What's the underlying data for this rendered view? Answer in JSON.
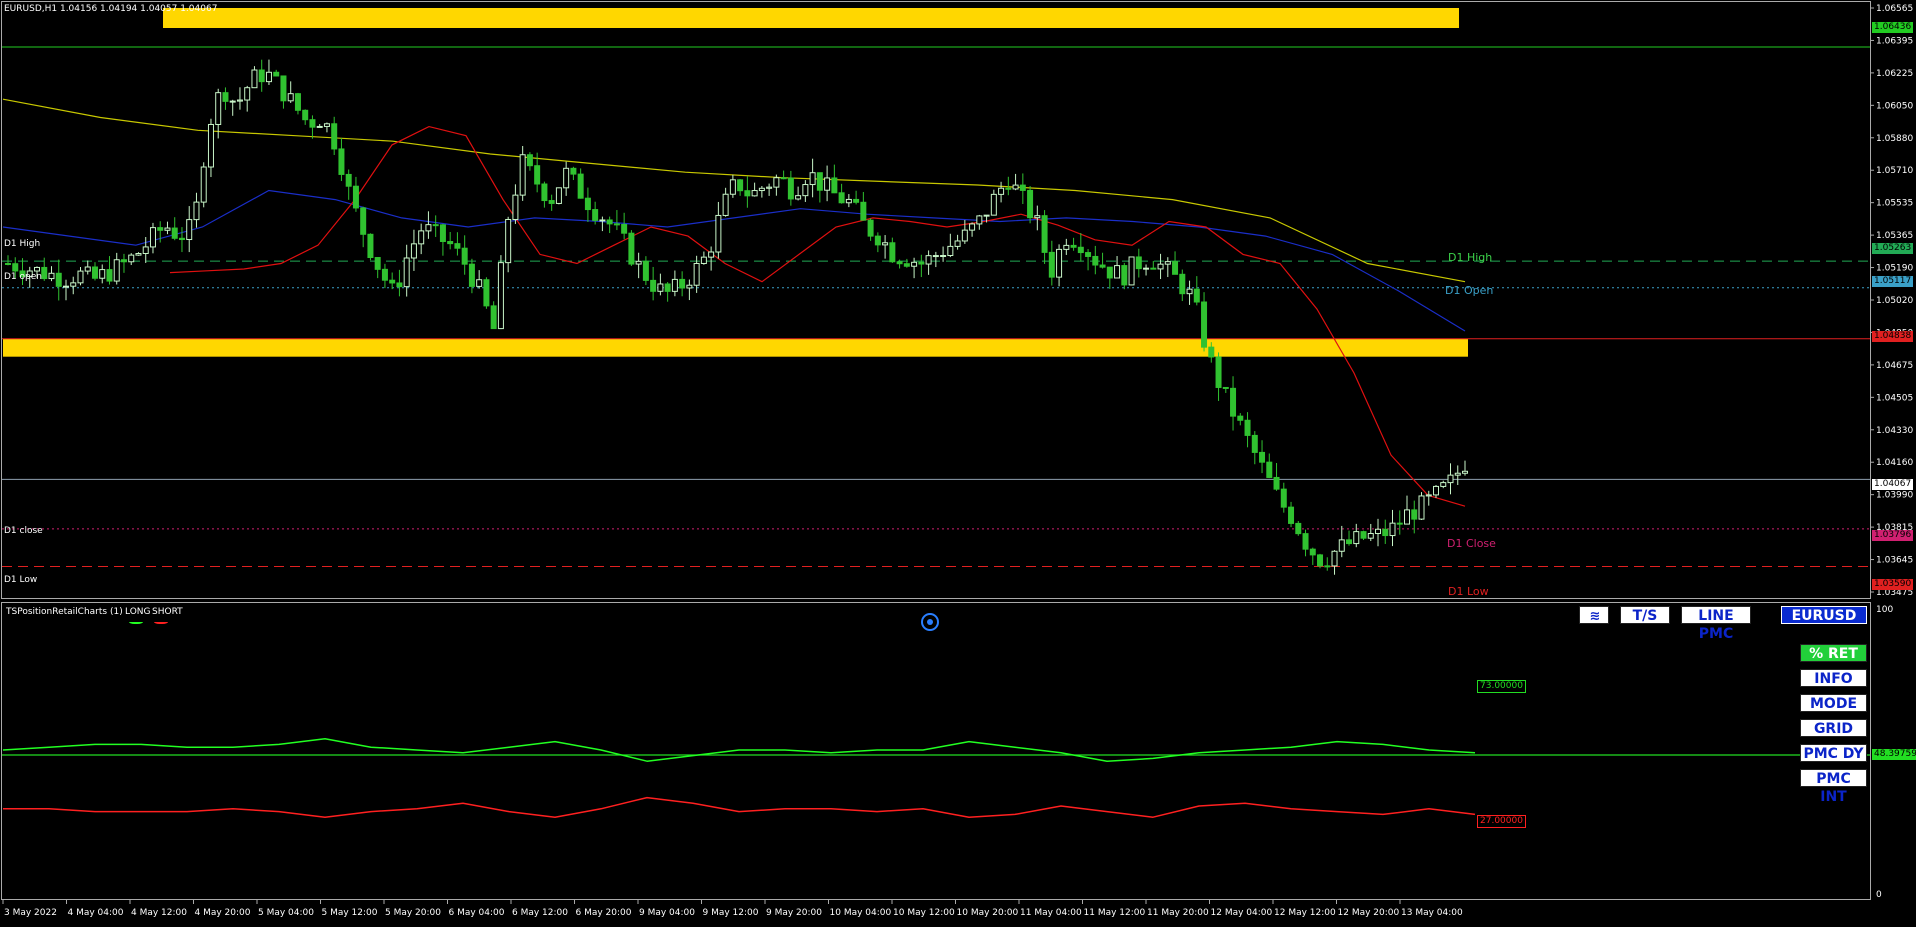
{
  "header": {
    "title": "EURUSD,H1  1.04156 1.04194 1.04057 1.04067"
  },
  "colors": {
    "bull": "#c8f5c8",
    "bear": "#30c230",
    "zone": "#ffd700",
    "ema_red": "#e01010",
    "ma_blue": "#1a2ec8",
    "ma_yellow": "#c8c800",
    "long": "#22ff22",
    "short": "#ff2020",
    "grid_axis": "#aaaaaa"
  },
  "levels": {
    "d1_high": {
      "label_left": "D1 High",
      "label_right": "D1 High",
      "value": 1.05263,
      "tag": "1.05263"
    },
    "d1_open": {
      "label_left": "D1 open",
      "label_right": "D1 Open",
      "value": 1.05117,
      "tag": "1.05117"
    },
    "d1_close": {
      "label_left": "D1 close",
      "label_right": "D1 Close",
      "value": 1.03796,
      "tag": "1.03796"
    },
    "d1_low": {
      "label_left": "D1 Low",
      "label_right": "D1 Low",
      "value": 1.0359,
      "tag": "1.03590"
    },
    "current": {
      "tag": "1.04067",
      "value": 1.04067
    },
    "resistance": {
      "tag": "1.06436",
      "value": 1.06436
    },
    "support": {
      "tag": "1.04838",
      "value": 1.04838
    }
  },
  "indicator": {
    "name": "TSPositionRetailCharts (1)",
    "long_label": "LONG",
    "short_label": "SHORT",
    "long_value": "73.00000",
    "short_value": "27.00000",
    "mid_value": "48.39759",
    "scale_top": "100",
    "scale_bottom": "0"
  },
  "buttons": {
    "ts": "T/S",
    "line_pmc": "LINE PMC",
    "symbol": "EURUSD",
    "ret": "% RET",
    "info": "INFO",
    "mode": "MODE",
    "grid": "GRID",
    "pmc_dy": "PMC DY",
    "pmc_int": "PMC INT"
  },
  "chart_data": {
    "type": "candlestick",
    "symbol": "EURUSD",
    "timeframe": "H1",
    "ylim": [
      1.0345,
      1.0665
    ],
    "y_ticks": [
      "1.06565",
      "1.06395",
      "1.06225",
      "1.06050",
      "1.05880",
      "1.05710",
      "1.05535",
      "1.05365",
      "1.05190",
      "1.05020",
      "1.04850",
      "1.04675",
      "1.04505",
      "1.04330",
      "1.04160",
      "1.03990",
      "1.03815",
      "1.03645",
      "1.03475"
    ],
    "x_ticks": [
      "3 May 2022",
      "4 May 04:00",
      "4 May 12:00",
      "4 May 20:00",
      "5 May 04:00",
      "5 May 12:00",
      "5 May 20:00",
      "6 May 04:00",
      "6 May 12:00",
      "6 May 20:00",
      "9 May 04:00",
      "9 May 12:00",
      "9 May 20:00",
      "10 May 04:00",
      "10 May 12:00",
      "10 May 20:00",
      "11 May 04:00",
      "11 May 12:00",
      "11 May 20:00",
      "12 May 04:00",
      "12 May 12:00",
      "12 May 20:00",
      "13 May 04:00"
    ],
    "close_path": [
      1.0525,
      1.0523,
      1.0521,
      1.0519,
      1.0517,
      1.0519,
      1.0516,
      1.052,
      1.0524,
      1.053,
      1.0538,
      1.0546,
      1.054,
      1.0545,
      1.06,
      1.0622,
      1.0612,
      1.0625,
      1.063,
      1.0622,
      1.0612,
      1.0602,
      1.0605,
      1.059,
      1.056,
      1.054,
      1.0522,
      1.0508,
      1.053,
      1.0545,
      1.054,
      1.0535,
      1.0525,
      1.051,
      1.0489,
      1.055,
      1.058,
      1.057,
      1.056,
      1.0575,
      1.0565,
      1.0555,
      1.0548,
      1.0538,
      1.0525,
      1.0515,
      1.0508,
      1.0512,
      1.052,
      1.053,
      1.0555,
      1.057,
      1.0562,
      1.0568,
      1.0572,
      1.0565,
      1.0575,
      1.0568,
      1.0562,
      1.0558,
      1.0545,
      1.054,
      1.053,
      1.0528,
      1.0525,
      1.053,
      1.0535,
      1.054,
      1.0548,
      1.056,
      1.0572,
      1.056,
      1.0548,
      1.052,
      1.054,
      1.0538,
      1.0528,
      1.0522,
      1.0518,
      1.0525,
      1.0528,
      1.0522,
      1.0515,
      1.0505,
      1.0475,
      1.0455,
      1.044,
      1.0425,
      1.041,
      1.0395,
      1.0385,
      1.037,
      1.0362,
      1.0368,
      1.0372,
      1.0375,
      1.0376,
      1.038,
      1.0388,
      1.0392,
      1.0398,
      1.0405,
      1.0416
    ],
    "ma_red": [
      1.052,
      1.0521,
      1.0522,
      1.0525,
      1.0535,
      1.056,
      1.059,
      1.06,
      1.0595,
      1.056,
      1.053,
      1.0525,
      1.0535,
      1.0545,
      1.054,
      1.0525,
      1.0515,
      1.053,
      1.0545,
      1.055,
      1.0548,
      1.0545,
      1.0548,
      1.0552,
      1.0546,
      1.0538,
      1.0535,
      1.0548,
      1.0545,
      1.053,
      1.0525,
      1.05,
      1.0465,
      1.042,
      1.0398,
      1.0392
    ],
    "ma_blue": [
      1.0545,
      1.054,
      1.0535,
      1.0545,
      1.0565,
      1.056,
      1.055,
      1.0545,
      1.055,
      1.0548,
      1.0545,
      1.055,
      1.0555,
      1.0552,
      1.055,
      1.0548,
      1.055,
      1.0548,
      1.0545,
      1.054,
      1.053,
      1.051,
      1.0488
    ],
    "ma_yellow": [
      1.0615,
      1.0605,
      1.0598,
      1.0595,
      1.0592,
      1.0585,
      1.058,
      1.0575,
      1.0572,
      1.057,
      1.0568,
      1.0565,
      1.056,
      1.055,
      1.0525,
      1.0515
    ],
    "long_pct": [
      50,
      51,
      52,
      52,
      51,
      51,
      52,
      54,
      51,
      50,
      49,
      51,
      53,
      50,
      46,
      48,
      50,
      50,
      49,
      50,
      50,
      53,
      51,
      49,
      46,
      47,
      49,
      50,
      51,
      53,
      52,
      50,
      49
    ],
    "short_pct": [
      29,
      29,
      28,
      28,
      28,
      29,
      28,
      26,
      28,
      29,
      31,
      28,
      26,
      29,
      33,
      31,
      28,
      29,
      29,
      28,
      29,
      26,
      27,
      30,
      28,
      26,
      30,
      31,
      29,
      28,
      27,
      29,
      27
    ]
  }
}
